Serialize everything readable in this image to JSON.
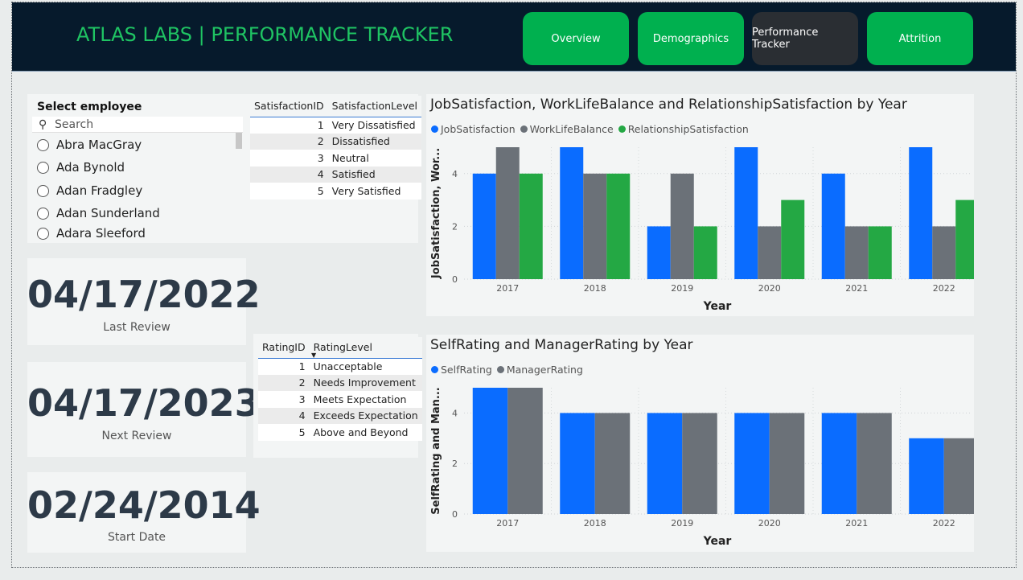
{
  "header": {
    "title": "ATLAS LABS | PERFORMANCE TRACKER",
    "nav": [
      {
        "label": "Overview",
        "active": false
      },
      {
        "label": "Demographics",
        "active": false
      },
      {
        "label": "Performance Tracker",
        "active": true
      },
      {
        "label": "Attrition",
        "active": false
      }
    ]
  },
  "employee_slicer": {
    "title": "Select employee",
    "search_placeholder": "Search",
    "items": [
      "Abra MacGray",
      "Ada Bynold",
      "Adan Fradgley",
      "Adan Sunderland",
      "Adara Sleeford"
    ]
  },
  "satisfaction_table": {
    "headers": [
      "SatisfactionID",
      "SatisfactionLevel"
    ],
    "rows": [
      [
        "1",
        "Very Dissatisfied"
      ],
      [
        "2",
        "Dissatisfied"
      ],
      [
        "3",
        "Neutral"
      ],
      [
        "4",
        "Satisfied"
      ],
      [
        "5",
        "Very Satisfied"
      ]
    ]
  },
  "rating_table": {
    "headers": [
      "RatingID",
      "RatingLevel"
    ],
    "rows": [
      [
        "1",
        "Unacceptable"
      ],
      [
        "2",
        "Needs Improvement"
      ],
      [
        "3",
        "Meets Expectation"
      ],
      [
        "4",
        "Exceeds Expectation"
      ],
      [
        "5",
        "Above and Beyond"
      ]
    ]
  },
  "kpis": {
    "last_review": {
      "value": "04/17/2022",
      "label": "Last Review"
    },
    "next_review": {
      "value": "04/17/2023",
      "label": "Next Review"
    },
    "start_date": {
      "value": "02/24/2014",
      "label": "Start Date"
    }
  },
  "chart_data": [
    {
      "type": "bar",
      "title": "JobSatisfaction, WorkLifeBalance and RelationshipSatisfaction by Year",
      "xlabel": "Year",
      "ylabel": "JobSatisfaction, Wor...",
      "categories": [
        "2017",
        "2018",
        "2019",
        "2020",
        "2021",
        "2022"
      ],
      "series": [
        {
          "name": "JobSatisfaction",
          "color": "#0a6cff",
          "values": [
            4,
            5,
            2,
            5,
            4,
            5
          ]
        },
        {
          "name": "WorkLifeBalance",
          "color": "#6b7178",
          "values": [
            5,
            4,
            4,
            2,
            2,
            2
          ]
        },
        {
          "name": "RelationshipSatisfaction",
          "color": "#24a844",
          "values": [
            4,
            4,
            2,
            3,
            2,
            3
          ]
        }
      ],
      "ylim": [
        0,
        5
      ],
      "yticks": [
        0,
        2,
        4
      ],
      "legend": "top-left",
      "grid": true
    },
    {
      "type": "bar",
      "title": "SelfRating and ManagerRating by Year",
      "xlabel": "Year",
      "ylabel": "SelfRating and Man...",
      "categories": [
        "2017",
        "2018",
        "2019",
        "2020",
        "2021",
        "2022"
      ],
      "series": [
        {
          "name": "SelfRating",
          "color": "#0a6cff",
          "values": [
            5,
            4,
            4,
            4,
            4,
            3
          ]
        },
        {
          "name": "ManagerRating",
          "color": "#6b7178",
          "values": [
            5,
            4,
            4,
            4,
            4,
            3
          ]
        }
      ],
      "ylim": [
        0,
        5
      ],
      "yticks": [
        0,
        2,
        4
      ],
      "legend": "top-left",
      "grid": true
    }
  ]
}
